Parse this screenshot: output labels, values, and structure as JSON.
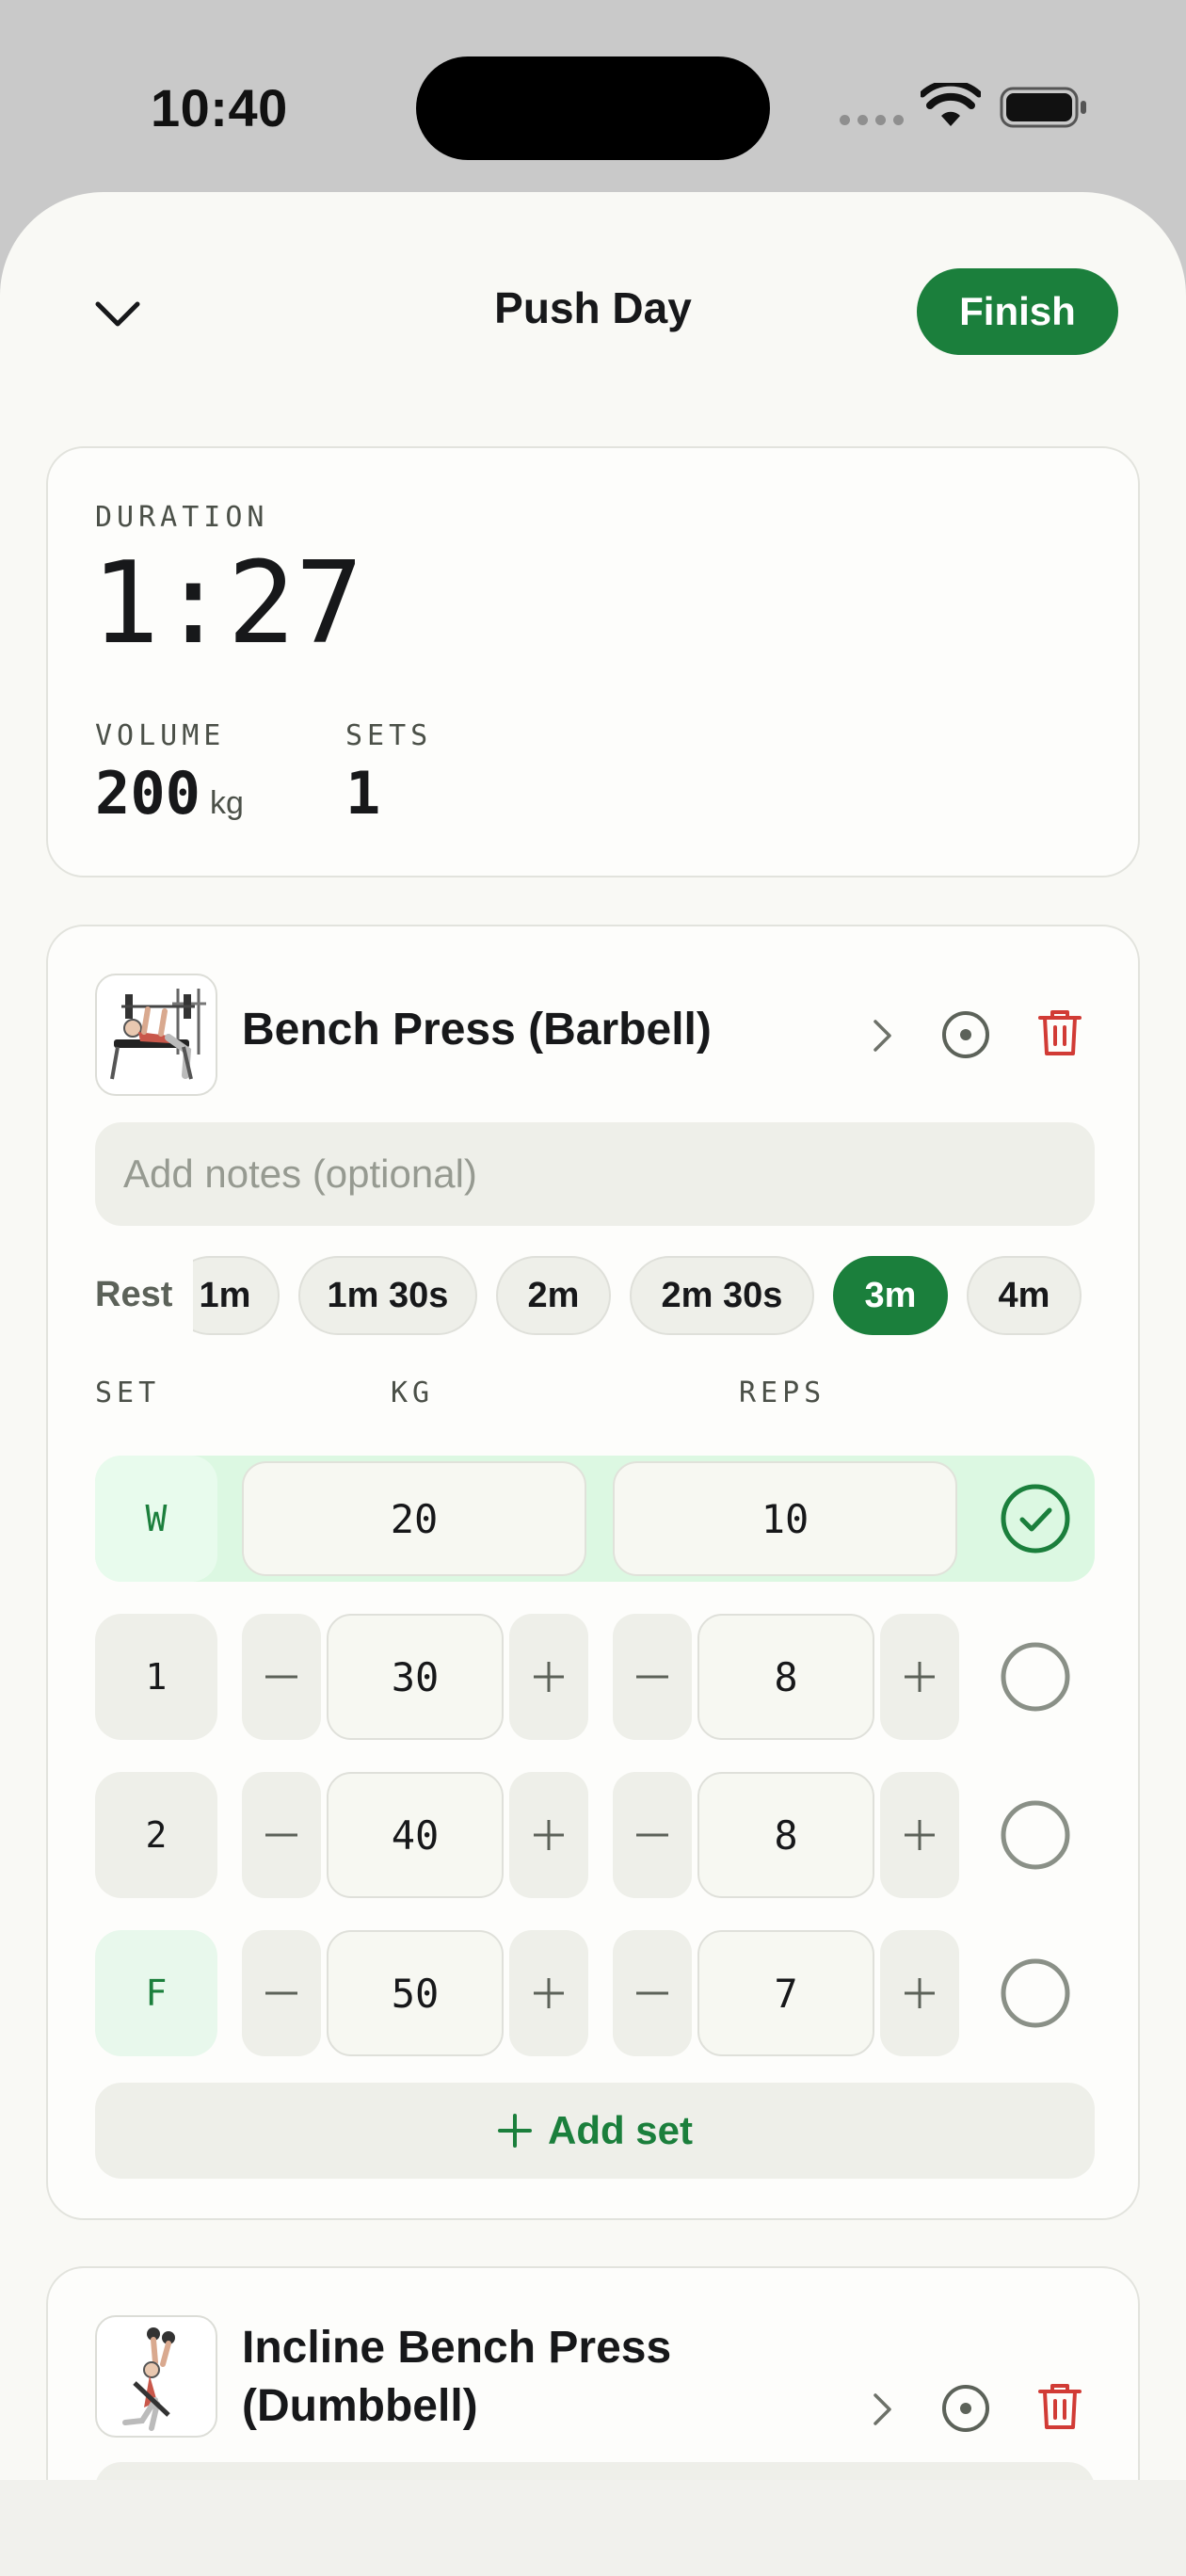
{
  "status_bar": {
    "time": "10:40"
  },
  "header": {
    "title": "Push Day",
    "finish_label": "Finish"
  },
  "summary": {
    "duration_label": "DURATION",
    "duration_value": "1:27",
    "volume_label": "VOLUME",
    "volume_value": "200",
    "volume_unit": "kg",
    "sets_label": "SETS",
    "sets_value": "1"
  },
  "exercises": [
    {
      "name": "Bench Press (Barbell)",
      "notes_placeholder": "Add notes (optional)",
      "rest_label": "Rest",
      "rest_options": [
        "1m",
        "1m 30s",
        "2m",
        "2m 30s",
        "3m",
        "4m"
      ],
      "rest_selected": "3m",
      "columns": {
        "set": "SET",
        "weight": "KG",
        "reps": "REPS"
      },
      "sets": [
        {
          "label": "W",
          "weight": "20",
          "reps": "10",
          "completed": true
        },
        {
          "label": "1",
          "weight": "30",
          "reps": "8",
          "completed": false
        },
        {
          "label": "2",
          "weight": "40",
          "reps": "8",
          "completed": false
        },
        {
          "label": "F",
          "weight": "50",
          "reps": "7",
          "completed": false
        }
      ],
      "add_set_label": "Add set"
    },
    {
      "name_line1": "Incline Bench Press",
      "name_line2": "(Dumbbell)"
    }
  ],
  "colors": {
    "accent": "#1b7f3c",
    "completed_row": "#dcf8e2",
    "delete": "#d13b35",
    "surface": "#f9f9f5"
  },
  "icons": {
    "collapse": "chevron-down-icon",
    "detail": "chevron-right-icon",
    "rest_timer": "timer-icon",
    "delete": "trash-icon",
    "complete": "check-circle-icon",
    "decrement": "minus-icon",
    "increment": "plus-icon"
  }
}
